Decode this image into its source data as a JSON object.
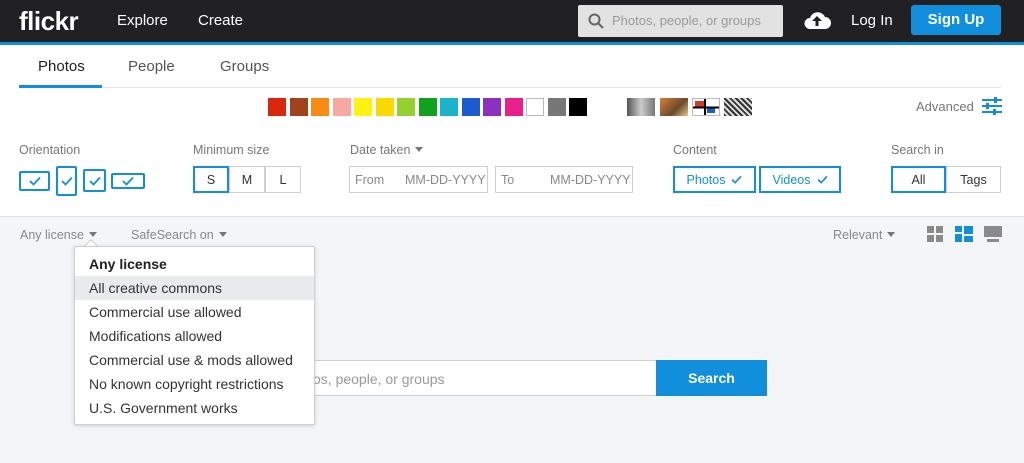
{
  "nav": {
    "logo": "flickr",
    "explore": "Explore",
    "create": "Create",
    "search_placeholder": "Photos, people, or groups",
    "login": "Log In",
    "signup": "Sign Up"
  },
  "tabs": [
    {
      "label": "Photos",
      "active": true
    },
    {
      "label": "People",
      "active": false
    },
    {
      "label": "Groups",
      "active": false
    }
  ],
  "colors": [
    "#d9260c",
    "#a0431c",
    "#f88b12",
    "#f7a8a3",
    "#fff213",
    "#fbd900",
    "#94d12f",
    "#10a21f",
    "#1ab3c9",
    "#1a5bd0",
    "#8d30c1",
    "#ea1f8c",
    "#ffffff",
    "#777777",
    "#000000"
  ],
  "advanced": "Advanced",
  "filters": {
    "orientation_label": "Orientation",
    "min_size_label": "Minimum size",
    "sizes": [
      "S",
      "M",
      "L"
    ],
    "date_label": "Date taken",
    "from_label": "From",
    "from_placeholder": "MM-DD-YYYY",
    "to_label": "To",
    "to_placeholder": "MM-DD-YYYY",
    "content_label": "Content",
    "content_photos": "Photos",
    "content_videos": "Videos",
    "search_in_label": "Search in",
    "search_in_all": "All",
    "search_in_tags": "Tags"
  },
  "subbar": {
    "license": "Any license",
    "safesearch": "SafeSearch on",
    "sort": "Relevant"
  },
  "license_menu": [
    {
      "label": "Any license",
      "header": true
    },
    {
      "label": "All creative commons",
      "hover": true
    },
    {
      "label": "Commercial use allowed"
    },
    {
      "label": "Modifications allowed"
    },
    {
      "label": "Commercial use & mods allowed"
    },
    {
      "label": "No known copyright restrictions"
    },
    {
      "label": "U.S. Government works"
    }
  ],
  "main_search": {
    "visible_text": "os, people, or groups",
    "button": "Search"
  }
}
